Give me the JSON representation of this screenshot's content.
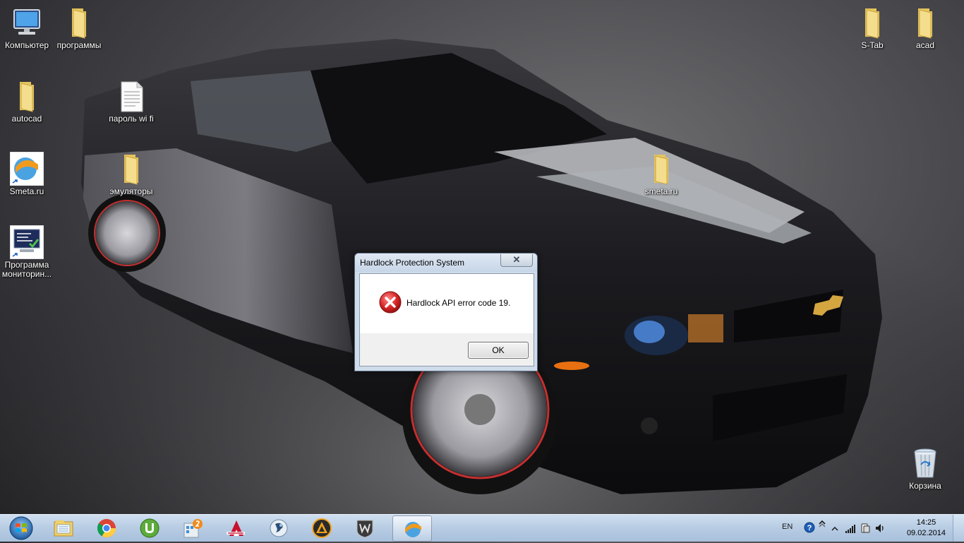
{
  "desktop": {
    "icons": [
      {
        "label": "Компьютер"
      },
      {
        "label": "программы"
      },
      {
        "label": "autocad"
      },
      {
        "label": "пароль wi fi"
      },
      {
        "label": "Smeta.ru"
      },
      {
        "label": "эмуляторы"
      },
      {
        "label": "smeta.ru"
      },
      {
        "label": "Программа мониторин..."
      },
      {
        "label": "S-Tab"
      },
      {
        "label": "acad"
      },
      {
        "label": "Корзина"
      }
    ]
  },
  "dialog": {
    "title": "Hardlock Protection System",
    "message": "Hardlock API error code 19.",
    "ok_label": "OK",
    "close_glyph": "✕"
  },
  "taskbar": {
    "apps": [
      "explorer-icon",
      "chrome-icon",
      "utorrent-icon",
      "tasks-icon",
      "autocad-icon",
      "messenger-icon",
      "aimp-icon",
      "world-of-tanks-icon",
      "smeta-icon"
    ],
    "language": "EN",
    "time": "14:25",
    "date": "09.02.2014"
  },
  "colors": {
    "folder": "#f2d77d",
    "error_red": "#d62424",
    "taskbar": "#b9cde4"
  }
}
